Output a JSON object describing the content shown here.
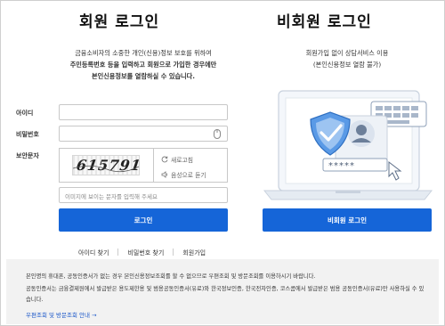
{
  "member": {
    "title": "회원 로그인",
    "desc_line1": "금융소비자의 소중한 개인(신용)정보 보호를 위하여",
    "desc_line2": "주민등록번호 등을 입력하고 회원으로 가입한 경우에만",
    "desc_line3": "본인신용정보를 열람하실 수 있습니다.",
    "id_label": "아이디",
    "pw_label": "비밀번호",
    "captcha_label": "보안문자",
    "captcha_text": "615791",
    "refresh_label": "새로고침",
    "audio_label": "음성으로 듣기",
    "captcha_placeholder": "이미지에 보이는 문자를 입력해 주세요",
    "login_button": "로그인",
    "links": [
      "아이디 찾기",
      "비밀번호 찾기",
      "회원가입"
    ]
  },
  "guest": {
    "title": "비회원 로그인",
    "desc_line1": "회원가입 없이 상담서비스 이용",
    "desc_line2": "(본인신용정보 열람 불가)",
    "login_button": "비회원 로그인",
    "illustration_password": "*****"
  },
  "notice": {
    "line1": "본인명의 휴대폰, 공동인증서가 없는 경우 본인신용정보조회를 할 수 없으므로 우편조회 및 방문조회를 이용하시기 바랍니다.",
    "line2": "공동인증서는 금융결제원에서 발급받은 용도제한용 및 범용공동인증서(유료)와 한국정보인증, 한국전자인증, 코스콤에서 발급받은 범용 공동인증서(유료)만 사용하실 수 있",
    "line3": "습니다.",
    "link": "우편조회 및 방문조회 안내 →"
  },
  "colors": {
    "primary": "#1565d8",
    "notice_bg": "#f2f2f2"
  }
}
